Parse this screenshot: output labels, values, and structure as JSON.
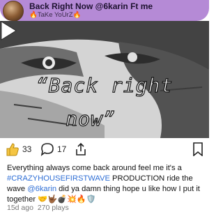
{
  "now_playing": {
    "title": "Back Right Now @6karin Ft me",
    "artist": "🔥TaKe YoUrZ🔥"
  },
  "video": {
    "overlay_line1": "“Back right",
    "overlay_line2": "now”"
  },
  "actions": {
    "like_count": "33",
    "comment_count": "17"
  },
  "post": {
    "caption_part1": "Everything always come back around feel me it's a ",
    "hashtag": "#CRAZYHOUSEFIRSTWAVE",
    "caption_part2": " PRODUCTION ride the wave ",
    "mention": "@6karin",
    "caption_part3": " did ya damn thing hope u like how I put it together 🤝🤟🏾💣💥🔥🛡️",
    "time_ago": "15d ago",
    "plays": "270 plays"
  },
  "colors": {
    "now_playing_bg": "#b58ad6",
    "link": "#2f6fd6"
  }
}
